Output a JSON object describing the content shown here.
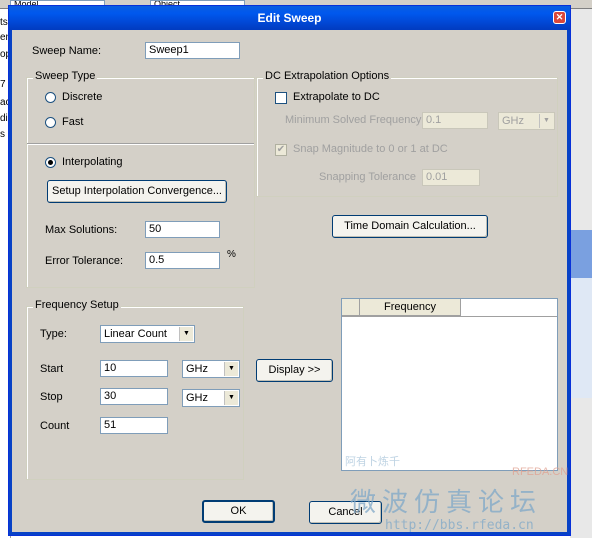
{
  "background_app": {
    "toolbar_field_1": "Model",
    "toolbar_field_2": "Object",
    "left_panel_fragments": [
      "ts",
      "en",
      "op",
      "7",
      "ac",
      "din",
      "s"
    ]
  },
  "dialog": {
    "title": "Edit Sweep",
    "sweep_name_label": "Sweep Name:",
    "sweep_name_value": "Sweep1",
    "sweep_type": {
      "title": "Sweep Type",
      "options": [
        "Discrete",
        "Fast",
        "Interpolating"
      ],
      "selected": "Interpolating",
      "setup_button": "Setup Interpolation Convergence...",
      "max_solutions_label": "Max Solutions:",
      "max_solutions_value": "50",
      "error_tolerance_label": "Error Tolerance:",
      "error_tolerance_value": "0.5",
      "error_tolerance_unit": "%"
    },
    "dc_extrapolation": {
      "title": "DC Extrapolation Options",
      "extrapolate_label": "Extrapolate to DC",
      "extrapolate_checked": false,
      "min_freq_label": "Minimum Solved Frequency",
      "min_freq_value": "0.1",
      "min_freq_unit": "GHz",
      "snap_label": "Snap Magnitude to 0 or 1 at DC",
      "snap_checked": true,
      "snap_tol_label": "Snapping Tolerance",
      "snap_tol_value": "0.01"
    },
    "time_domain_button": "Time Domain Calculation...",
    "frequency_setup": {
      "title": "Frequency Setup",
      "type_label": "Type:",
      "type_value": "Linear Count",
      "start_label": "Start",
      "start_value": "10",
      "start_unit": "GHz",
      "stop_label": "Stop",
      "stop_value": "30",
      "stop_unit": "GHz",
      "count_label": "Count",
      "count_value": "51"
    },
    "display_button": "Display >>",
    "frequency_table": {
      "column": "Frequency"
    },
    "ok_button": "OK",
    "cancel_button": "Cancel"
  },
  "watermark": {
    "text_1": "RFEDA.CN",
    "text_2": "微波仿真论坛",
    "text_3": "http://bbs.rfeda.cn",
    "text_4": "阿有卜炼千"
  },
  "colors": {
    "title_bar": "#0054e3",
    "dialog_face": "#d4d0c8",
    "watermark": "#7fa8c8"
  }
}
